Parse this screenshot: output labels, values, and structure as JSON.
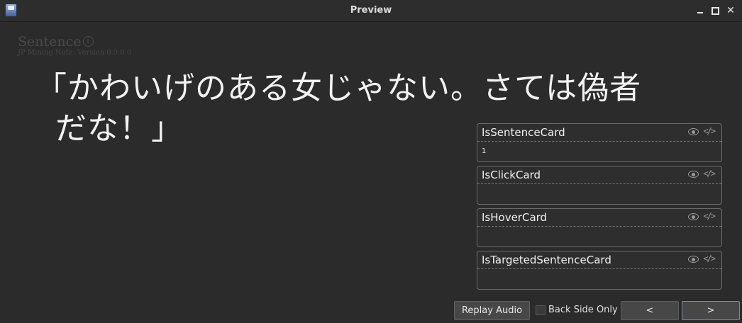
{
  "window": {
    "title": "Preview"
  },
  "note": {
    "label": "Sentence",
    "info_icon": "ⓘ",
    "version": "JP Mining Note: Version 0.9.0.0"
  },
  "sentence": {
    "line1": "「かわいげのある女じゃない。さては偽者",
    "line2": "だな！」"
  },
  "fields": [
    {
      "name": "IsSentenceCard",
      "value": "1"
    },
    {
      "name": "IsClickCard",
      "value": ""
    },
    {
      "name": "IsHoverCard",
      "value": ""
    },
    {
      "name": "IsTargetedSentenceCard",
      "value": ""
    }
  ],
  "footer": {
    "replay_label": "Replay Audio",
    "back_side_label": "Back Side Only",
    "back_side_checked": false,
    "prev_label": "<",
    "next_label": ">"
  },
  "icons": {
    "eye": "eye-icon",
    "code": "code-icon",
    "close": "close-icon"
  }
}
